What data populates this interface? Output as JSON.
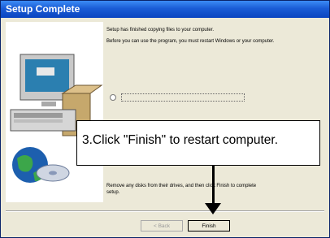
{
  "window": {
    "title": "Setup Complete"
  },
  "content": {
    "line1": "Setup has finished copying files to your computer.",
    "line2": "Before you can use the program, you must restart Windows or your computer.",
    "line3": "Remove any disks from their drives, and then click Finish to complete setup."
  },
  "buttons": {
    "back": "< Back",
    "finish": "Finish"
  },
  "callout": {
    "text": "3.Click \"Finish\" to restart computer."
  },
  "icons": {
    "computer": "computer-icon",
    "globe": "globe-icon",
    "disk": "disk-icon"
  },
  "colors": {
    "titlebar": "#0b45c0",
    "window_bg": "#ece9d8"
  }
}
